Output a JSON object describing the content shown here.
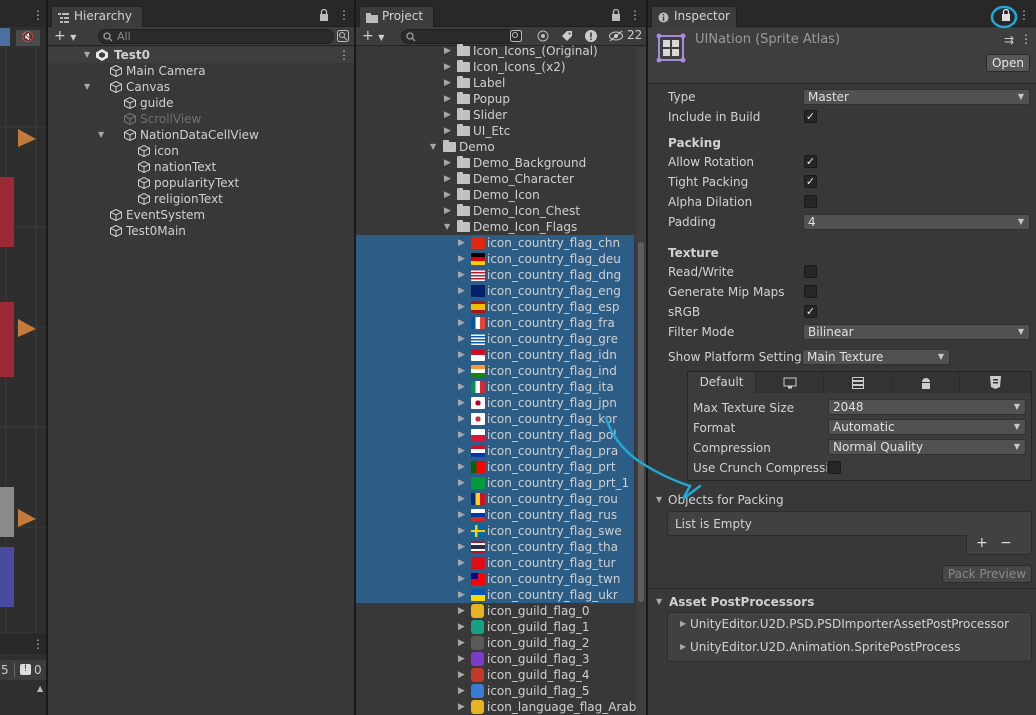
{
  "hierarchy": {
    "tab_label": "Hierarchy",
    "search_placeholder": "All",
    "scene_name": "Test0",
    "items": [
      {
        "label": "Main Camera"
      },
      {
        "label": "Canvas"
      },
      {
        "label": "guide"
      },
      {
        "label": "ScrollView"
      },
      {
        "label": "NationDataCellView"
      },
      {
        "label": "icon"
      },
      {
        "label": "nationText"
      },
      {
        "label": "popularityText"
      },
      {
        "label": "religionText"
      },
      {
        "label": "EventSystem"
      },
      {
        "label": "Test0Main"
      }
    ]
  },
  "left_strip": {
    "count_a": "5",
    "count_b": "0"
  },
  "project": {
    "tab_label": "Project",
    "hidden_count": "22",
    "items": [
      {
        "label": "Icon_Icons_(Original)"
      },
      {
        "label": "Icon_Icons_(x2)"
      },
      {
        "label": "Label"
      },
      {
        "label": "Popup"
      },
      {
        "label": "Slider"
      },
      {
        "label": "UI_Etc"
      },
      {
        "label": "Demo"
      },
      {
        "label": "Demo_Background"
      },
      {
        "label": "Demo_Character"
      },
      {
        "label": "Demo_Icon"
      },
      {
        "label": "Demo_Icon_Chest"
      },
      {
        "label": "Demo_Icon_Flags"
      },
      {
        "label": "icon_country_flag_chn"
      },
      {
        "label": "icon_country_flag_deu"
      },
      {
        "label": "icon_country_flag_dng"
      },
      {
        "label": "icon_country_flag_eng"
      },
      {
        "label": "icon_country_flag_esp"
      },
      {
        "label": "icon_country_flag_fra"
      },
      {
        "label": "icon_country_flag_gre"
      },
      {
        "label": "icon_country_flag_idn"
      },
      {
        "label": "icon_country_flag_ind"
      },
      {
        "label": "icon_country_flag_ita"
      },
      {
        "label": "icon_country_flag_jpn"
      },
      {
        "label": "icon_country_flag_kor"
      },
      {
        "label": "icon_country_flag_pol"
      },
      {
        "label": "icon_country_flag_pra"
      },
      {
        "label": "icon_country_flag_prt"
      },
      {
        "label": "icon_country_flag_prt_1"
      },
      {
        "label": "icon_country_flag_rou"
      },
      {
        "label": "icon_country_flag_rus"
      },
      {
        "label": "icon_country_flag_swe"
      },
      {
        "label": "icon_country_flag_tha"
      },
      {
        "label": "icon_country_flag_tur"
      },
      {
        "label": "icon_country_flag_twn"
      },
      {
        "label": "icon_country_flag_ukr"
      },
      {
        "label": "icon_guild_flag_0"
      },
      {
        "label": "icon_guild_flag_1"
      },
      {
        "label": "icon_guild_flag_2"
      },
      {
        "label": "icon_guild_flag_3"
      },
      {
        "label": "icon_guild_flag_4"
      },
      {
        "label": "icon_guild_flag_5"
      },
      {
        "label": "icon_language_flag_Arabic"
      }
    ]
  },
  "inspector": {
    "tab_label": "Inspector",
    "asset_title": "UINation (Sprite Atlas)",
    "open_label": "Open",
    "type_label": "Type",
    "type_value": "Master",
    "include_in_build_label": "Include in Build",
    "packing_header": "Packing",
    "allow_rotation_label": "Allow Rotation",
    "tight_packing_label": "Tight Packing",
    "alpha_dilation_label": "Alpha Dilation",
    "padding_label": "Padding",
    "padding_value": "4",
    "texture_header": "Texture",
    "read_write_label": "Read/Write",
    "generate_mip_maps_label": "Generate Mip Maps",
    "srgb_label": "sRGB",
    "filter_mode_label": "Filter Mode",
    "filter_mode_value": "Bilinear",
    "show_platform_settings_label": "Show Platform Settings",
    "platform_settings_value": "Main Texture",
    "platform_tab_default": "Default",
    "max_texture_size_label": "Max Texture Size",
    "max_texture_size_value": "2048",
    "format_label": "Format",
    "format_value": "Automatic",
    "compression_label": "Compression",
    "compression_value": "Normal Quality",
    "use_crunch_label": "Use Crunch Compressic",
    "objects_for_packing_label": "Objects for Packing",
    "list_empty_label": "List is Empty",
    "plus_label": "+",
    "minus_label": "−",
    "pack_preview_label": "Pack Preview",
    "asset_postprocessors_label": "Asset PostProcessors",
    "postprocessors": [
      {
        "label": "UnityEditor.U2D.PSD.PSDImporterAssetPostProcessor"
      },
      {
        "label": "UnityEditor.U2D.Animation.SpritePostProcess"
      }
    ]
  },
  "colors": {
    "selection": "#2c5d87",
    "annotation": "#1fa8d6",
    "panel_bg": "#383838"
  }
}
